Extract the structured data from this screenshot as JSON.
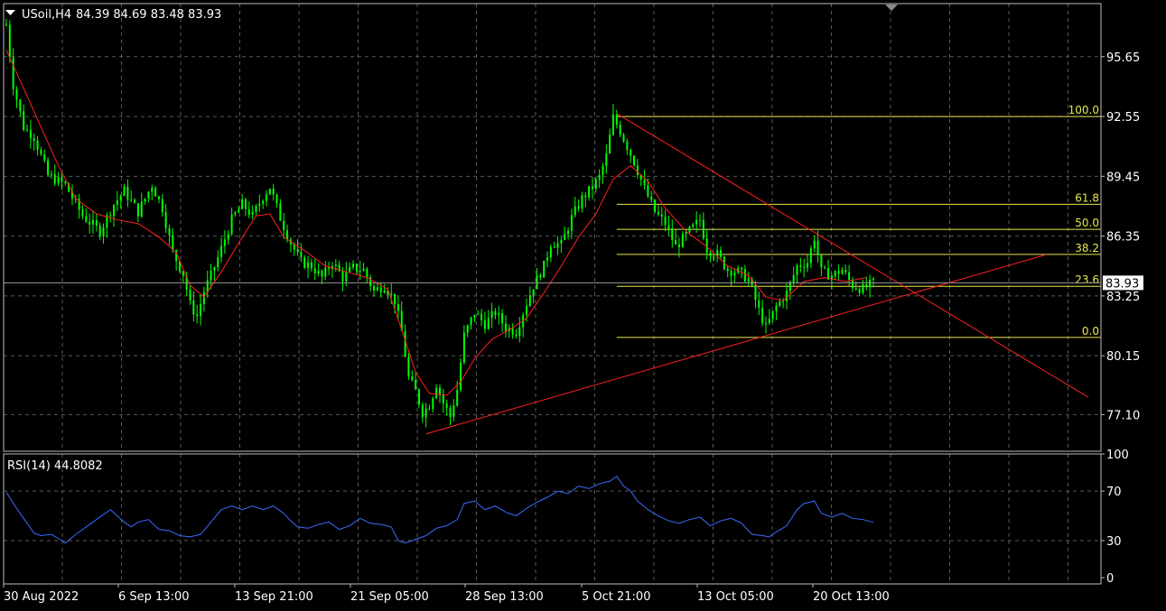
{
  "header": {
    "symbol": "USoil,H4",
    "ohlc": "84.39 84.69 83.48 83.93",
    "menu_icon": "triangle-down-icon"
  },
  "colors": {
    "background": "#000000",
    "grid": "#5a5a5a",
    "text": "#ffffff",
    "candles": "#00ff00",
    "moving_average": "#ff2020",
    "trendlines": "#ff2020",
    "fibonacci": "#e8e84a",
    "rsi": "#3b6bff",
    "price_tag_bg": "#ffffff",
    "price_tag_text": "#000000"
  },
  "chart_data": [
    {
      "type": "candlestick",
      "title": "USoil,H4",
      "ohlc_last": {
        "open": 84.39,
        "high": 84.69,
        "low": 83.48,
        "close": 83.93
      },
      "current_price_label": "83.93",
      "y_ticks": [
        "95.65",
        "92.55",
        "89.45",
        "86.35",
        "83.25",
        "80.15",
        "77.10"
      ],
      "ylim": [
        75.2,
        98.4
      ],
      "x_tick_labels": [
        "30 Aug 2022",
        "6 Sep 13:00",
        "13 Sep 21:00",
        "21 Sep 05:00",
        "28 Sep 13:00",
        "5 Oct 21:00",
        "13 Oct 05:00",
        "20 Oct 13:00"
      ],
      "grid": true,
      "close_path": [
        [
          0,
          97.3
        ],
        [
          2,
          94.2
        ],
        [
          5,
          92.0
        ],
        [
          8,
          91.5
        ],
        [
          12,
          89.5
        ],
        [
          17,
          89.0
        ],
        [
          22,
          87.4
        ],
        [
          27,
          86.6
        ],
        [
          31,
          88.0
        ],
        [
          34,
          88.7
        ],
        [
          38,
          87.6
        ],
        [
          42,
          89.0
        ],
        [
          45,
          87.8
        ],
        [
          48,
          85.5
        ],
        [
          51,
          84.4
        ],
        [
          53,
          82.8
        ],
        [
          55,
          82.2
        ],
        [
          57,
          83.5
        ],
        [
          59,
          84.3
        ],
        [
          62,
          85.7
        ],
        [
          65,
          87.2
        ],
        [
          68,
          88.0
        ],
        [
          71,
          87.4
        ],
        [
          74,
          88.4
        ],
        [
          76,
          88.9
        ],
        [
          79,
          87.3
        ],
        [
          82,
          86.0
        ],
        [
          85,
          85.0
        ],
        [
          88,
          84.8
        ],
        [
          91,
          84.2
        ],
        [
          94,
          85.0
        ],
        [
          97,
          84.2
        ],
        [
          100,
          84.7
        ],
        [
          103,
          84.6
        ],
        [
          106,
          83.5
        ],
        [
          109,
          83.8
        ],
        [
          112,
          83.0
        ],
        [
          114,
          81.4
        ],
        [
          116,
          79.0
        ],
        [
          118,
          78.3
        ],
        [
          120,
          77.2
        ],
        [
          122,
          77.6
        ],
        [
          124,
          78.7
        ],
        [
          126,
          77.7
        ],
        [
          128,
          77.0
        ],
        [
          130,
          78.4
        ],
        [
          132,
          81.2
        ],
        [
          135,
          82.4
        ],
        [
          138,
          81.8
        ],
        [
          141,
          82.4
        ],
        [
          144,
          81.6
        ],
        [
          147,
          81.4
        ],
        [
          149,
          82.4
        ],
        [
          152,
          83.8
        ],
        [
          155,
          84.8
        ],
        [
          157,
          86.0
        ],
        [
          160,
          85.9
        ],
        [
          163,
          87.3
        ],
        [
          166,
          88.3
        ],
        [
          169,
          88.9
        ],
        [
          171,
          89.4
        ],
        [
          173,
          90.5
        ],
        [
          175,
          92.5
        ],
        [
          177,
          91.8
        ],
        [
          179,
          91.0
        ],
        [
          181,
          90.2
        ],
        [
          184,
          88.8
        ],
        [
          187,
          87.6
        ],
        [
          190,
          87.0
        ],
        [
          193,
          85.8
        ],
        [
          196,
          86.4
        ],
        [
          198,
          86.8
        ],
        [
          200,
          87.2
        ],
        [
          202,
          85.7
        ],
        [
          205,
          85.4
        ],
        [
          208,
          84.6
        ],
        [
          211,
          84.5
        ],
        [
          214,
          84.1
        ],
        [
          217,
          82.5
        ],
        [
          219,
          81.6
        ],
        [
          222,
          82.7
        ],
        [
          225,
          83.4
        ],
        [
          228,
          84.8
        ],
        [
          231,
          85.0
        ],
        [
          233,
          86.3
        ],
        [
          235,
          84.5
        ],
        [
          238,
          84.3
        ],
        [
          241,
          84.6
        ],
        [
          244,
          83.8
        ],
        [
          247,
          83.6
        ],
        [
          250,
          83.93
        ]
      ],
      "moving_average": [
        [
          0,
          96.0
        ],
        [
          5,
          94.0
        ],
        [
          10,
          92.0
        ],
        [
          15,
          90.0
        ],
        [
          20,
          88.3
        ],
        [
          26,
          87.5
        ],
        [
          32,
          87.2
        ],
        [
          38,
          87.0
        ],
        [
          44,
          86.3
        ],
        [
          49,
          85.5
        ],
        [
          53,
          83.8
        ],
        [
          57,
          83.2
        ],
        [
          62,
          84.5
        ],
        [
          67,
          86.0
        ],
        [
          72,
          87.4
        ],
        [
          76,
          87.5
        ],
        [
          80,
          86.3
        ],
        [
          86,
          85.6
        ],
        [
          92,
          84.8
        ],
        [
          98,
          84.5
        ],
        [
          104,
          84.2
        ],
        [
          110,
          83.6
        ],
        [
          114,
          81.5
        ],
        [
          118,
          79.3
        ],
        [
          122,
          78.2
        ],
        [
          127,
          78.1
        ],
        [
          131,
          78.8
        ],
        [
          135,
          80.0
        ],
        [
          140,
          81.0
        ],
        [
          146,
          81.6
        ],
        [
          150,
          82.1
        ],
        [
          155,
          83.4
        ],
        [
          160,
          84.8
        ],
        [
          165,
          86.3
        ],
        [
          170,
          87.5
        ],
        [
          175,
          89.3
        ],
        [
          180,
          90.0
        ],
        [
          185,
          89.2
        ],
        [
          190,
          87.8
        ],
        [
          196,
          86.6
        ],
        [
          202,
          85.8
        ],
        [
          208,
          84.8
        ],
        [
          214,
          84.3
        ],
        [
          219,
          83.2
        ],
        [
          224,
          83.0
        ],
        [
          230,
          84.0
        ],
        [
          236,
          84.2
        ],
        [
          242,
          84.0
        ],
        [
          248,
          84.2
        ]
      ],
      "trendlines": [
        {
          "from": [
            176,
            92.7
          ],
          "to": [
            312,
            78.0
          ]
        },
        {
          "from": [
            121,
            76.1
          ],
          "to": [
            300,
            85.4
          ]
        }
      ],
      "fibonacci": {
        "start": 176,
        "levels": [
          {
            "label": "100.0",
            "value": 92.55
          },
          {
            "label": "61.8",
            "value": 88.0
          },
          {
            "label": "50.0",
            "value": 86.7
          },
          {
            "label": "38.2",
            "value": 85.4
          },
          {
            "label": "23.6",
            "value": 83.75
          },
          {
            "label": "0.0",
            "value": 81.1
          }
        ]
      }
    },
    {
      "type": "line",
      "title": "RSI(14) 44.8082",
      "y_ticks": [
        "100",
        "70",
        "30",
        "0"
      ],
      "levels": [
        70,
        30
      ],
      "ylim": [
        -5,
        100
      ],
      "values": [
        [
          0,
          69
        ],
        [
          3,
          56
        ],
        [
          6,
          44
        ],
        [
          8,
          36
        ],
        [
          10,
          34
        ],
        [
          13,
          35
        ],
        [
          16,
          30
        ],
        [
          17,
          28
        ],
        [
          20,
          35
        ],
        [
          23,
          41
        ],
        [
          26,
          47
        ],
        [
          28,
          51
        ],
        [
          30,
          55
        ],
        [
          32,
          50
        ],
        [
          34,
          45
        ],
        [
          36,
          41
        ],
        [
          38,
          45
        ],
        [
          41,
          47
        ],
        [
          44,
          39
        ],
        [
          47,
          38
        ],
        [
          50,
          34
        ],
        [
          53,
          33
        ],
        [
          56,
          35
        ],
        [
          59,
          45
        ],
        [
          62,
          55
        ],
        [
          65,
          58
        ],
        [
          68,
          55
        ],
        [
          71,
          58
        ],
        [
          74,
          55
        ],
        [
          77,
          58
        ],
        [
          80,
          52
        ],
        [
          82,
          46
        ],
        [
          84,
          41
        ],
        [
          87,
          40
        ],
        [
          90,
          43
        ],
        [
          93,
          45
        ],
        [
          96,
          39
        ],
        [
          99,
          42
        ],
        [
          102,
          48
        ],
        [
          105,
          44
        ],
        [
          108,
          43
        ],
        [
          111,
          41
        ],
        [
          113,
          30
        ],
        [
          115,
          28
        ],
        [
          118,
          31
        ],
        [
          121,
          34
        ],
        [
          124,
          40
        ],
        [
          127,
          42
        ],
        [
          130,
          47
        ],
        [
          132,
          60
        ],
        [
          135,
          62
        ],
        [
          138,
          55
        ],
        [
          141,
          58
        ],
        [
          144,
          53
        ],
        [
          147,
          50
        ],
        [
          150,
          56
        ],
        [
          153,
          61
        ],
        [
          156,
          65
        ],
        [
          159,
          70
        ],
        [
          162,
          68
        ],
        [
          165,
          74
        ],
        [
          168,
          72
        ],
        [
          171,
          76
        ],
        [
          174,
          78
        ],
        [
          176,
          82
        ],
        [
          178,
          74
        ],
        [
          180,
          70
        ],
        [
          182,
          62
        ],
        [
          185,
          55
        ],
        [
          188,
          50
        ],
        [
          191,
          46
        ],
        [
          194,
          44
        ],
        [
          197,
          47
        ],
        [
          200,
          49
        ],
        [
          203,
          42
        ],
        [
          206,
          46
        ],
        [
          209,
          48
        ],
        [
          212,
          44
        ],
        [
          215,
          35
        ],
        [
          218,
          34
        ],
        [
          220,
          33
        ],
        [
          222,
          37
        ],
        [
          225,
          42
        ],
        [
          228,
          55
        ],
        [
          230,
          60
        ],
        [
          233,
          62
        ],
        [
          235,
          52
        ],
        [
          238,
          49
        ],
        [
          241,
          52
        ],
        [
          244,
          48
        ],
        [
          247,
          47
        ],
        [
          250,
          44.8
        ]
      ]
    }
  ]
}
